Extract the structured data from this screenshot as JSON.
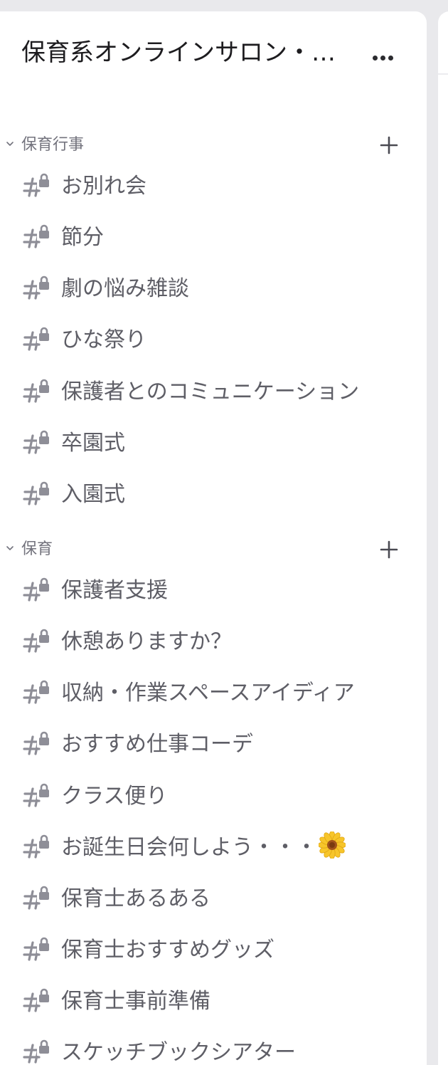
{
  "server": {
    "name": "保育系オンラインサロン・…",
    "more_label": "…"
  },
  "categories": [
    {
      "label": "保育行事",
      "channels": [
        {
          "name": "お別れ会"
        },
        {
          "name": "節分"
        },
        {
          "name": "劇の悩み雑談"
        },
        {
          "name": "ひな祭り"
        },
        {
          "name": "保護者とのコミュニケーション"
        },
        {
          "name": "卒園式"
        },
        {
          "name": "入園式"
        }
      ]
    },
    {
      "label": "保育",
      "channels": [
        {
          "name": "保護者支援"
        },
        {
          "name": "休憩ありますか？"
        },
        {
          "name": "収納・作業スペースアイディア"
        },
        {
          "name": "おすすめ仕事コーデ"
        },
        {
          "name": "クラス便り"
        },
        {
          "name": "お誕生日会何しよう・・・",
          "emoji": "flower-icon"
        },
        {
          "name": "保育士あるある"
        },
        {
          "name": "保育士おすすめグッズ"
        },
        {
          "name": "保育士事前準備"
        },
        {
          "name": "スケッチブックシアター"
        }
      ]
    }
  ],
  "icons": {
    "channel": "private-channel-hash-lock-icon",
    "category_toggle": "chevron-down-icon",
    "add": "plus-icon",
    "more": "more-dots-icon"
  },
  "colors": {
    "background": "#e9e9ec",
    "panel": "#ffffff",
    "server_name": "#1d1c1f",
    "category_label": "#73737d",
    "channel_name": "#5e5e66",
    "channel_icon": "#8e8e97"
  }
}
